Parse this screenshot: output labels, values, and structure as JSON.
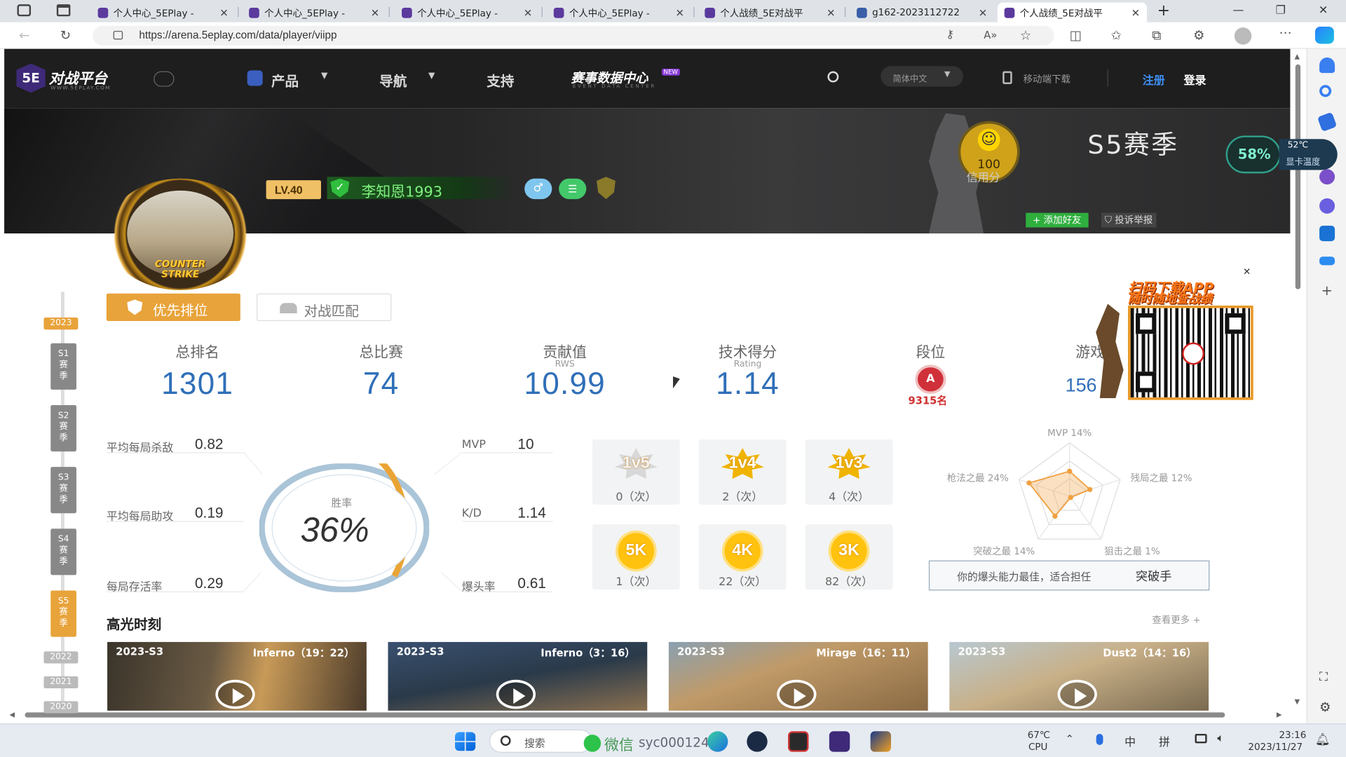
{
  "browser": {
    "tabs": [
      {
        "title": "个人中心_5EPlay -"
      },
      {
        "title": "个人中心_5EPlay -"
      },
      {
        "title": "个人中心_5EPlay -"
      },
      {
        "title": "个人中心_5EPlay -"
      },
      {
        "title": "个人战绩_5E对战平"
      },
      {
        "title": "g162-2023112722"
      },
      {
        "title": "个人战绩_5E对战平"
      }
    ],
    "url": "https://arena.5eplay.com/data/player/viipp"
  },
  "site": {
    "logo_text": "对战平台",
    "logo_sub": "WWW.5EPLAY.COM",
    "logo_badge": "5E",
    "nav": {
      "product": "产品",
      "guide": "导航",
      "support": "支持",
      "event": "赛事数据中心",
      "event_new": "NEW",
      "event_sub": "EVENT DATA CENTER"
    },
    "language": "简体中文",
    "mobile_download": "移动端下载",
    "register": "注册",
    "login": "登录"
  },
  "profile": {
    "level": "LV.40",
    "name": "李知恩1993",
    "season_title": "S5赛季",
    "credit_value": "100",
    "credit_label": "信用分",
    "add_friend": "+ 添加好友",
    "report": "投诉举报",
    "avatar_caption": "COUNTER STRIKE",
    "gpu_percent": "58%",
    "gpu_temp": "52℃",
    "gpu_label": "显卡温度"
  },
  "tabs": {
    "priority": "优先排位",
    "match": "对战匹配"
  },
  "timeline": {
    "year_current": "2023",
    "seasons": [
      {
        "label": "S1赛季"
      },
      {
        "label": "S2赛季"
      },
      {
        "label": "S3赛季"
      },
      {
        "label": "S4赛季"
      },
      {
        "label": "S5赛季"
      }
    ],
    "years": [
      "2022",
      "2021",
      "2020"
    ]
  },
  "stats": {
    "rank_label": "总排名",
    "rank_value": "1301",
    "matches_label": "总比赛",
    "matches_value": "74",
    "rws_label": "贡献值",
    "rws_sub": "RWS",
    "rws_value": "10.99",
    "rating_label": "技术得分",
    "rating_sub": "Rating",
    "rating_value": "1.14",
    "tier_label": "段位",
    "tier_badge": "A",
    "tier_rank": "9315名",
    "games_label": "游戏",
    "games_value": "156"
  },
  "metrics": {
    "kills_label": "平均每局杀敌",
    "kills_value": "0.82",
    "assists_label": "平均每局助攻",
    "assists_value": "0.19",
    "survival_label": "每局存活率",
    "survival_value": "0.29",
    "mvp_label": "MVP",
    "mvp_value": "10",
    "kd_label": "K/D",
    "kd_value": "1.14",
    "hs_label": "爆头率",
    "hs_value": "0.61",
    "winrate_label": "胜率",
    "winrate_value": "36%",
    "winrate_fraction": 0.36
  },
  "achievements": [
    {
      "badge": "1v5",
      "count": "0（次）"
    },
    {
      "badge": "1v4",
      "count": "2（次）"
    },
    {
      "badge": "1v3",
      "count": "4（次）"
    },
    {
      "badge": "5K",
      "count": "1（次）"
    },
    {
      "badge": "4K",
      "count": "22（次）"
    },
    {
      "badge": "3K",
      "count": "82（次）"
    }
  ],
  "radar": {
    "labels": [
      "MVP 14%",
      "残局之最 12%",
      "狙击之最 1%",
      "突破之最 14%",
      "枪法之最 24%"
    ],
    "values": [
      14,
      12,
      1,
      14,
      24
    ],
    "summary_prefix": "你的爆头能力最佳，适合担任",
    "summary_role": "突破手"
  },
  "qr": {
    "title1": "扫码下载APP",
    "title2": "随时随地查战绩"
  },
  "highlights": {
    "title": "高光时刻",
    "more": "查看更多 +",
    "items": [
      {
        "season": "2023-S3",
        "map": "Inferno（19：22）"
      },
      {
        "season": "2023-S3",
        "map": "Inferno（3：16）"
      },
      {
        "season": "2023-S3",
        "map": "Mirage（16：11）"
      },
      {
        "season": "2023-S3",
        "map": "Dust2（14：16）"
      }
    ]
  },
  "taskbar": {
    "search": "搜索",
    "wechat": "微信",
    "user": "syc000124",
    "weather": "67℃",
    "cpu": "CPU",
    "ime1": "中",
    "ime2": "拼",
    "time": "23:16",
    "date": "2023/11/27"
  }
}
